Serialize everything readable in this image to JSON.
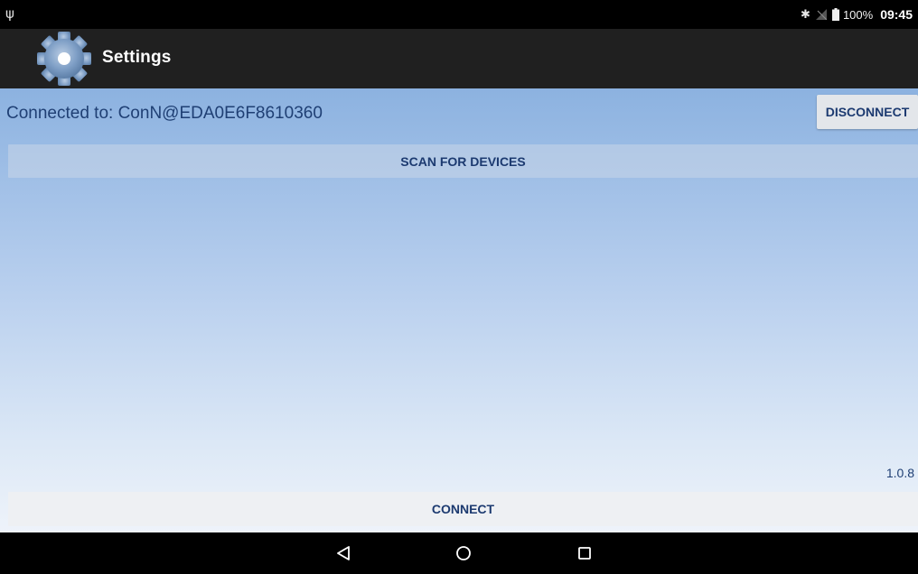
{
  "status_bar": {
    "usb_icon": "usb-icon",
    "bluetooth_icon": "bluetooth-icon",
    "signal_icon": "no-signal-icon",
    "battery_icon": "battery-icon",
    "battery_percent": "100%",
    "time": "09:45"
  },
  "action_bar": {
    "icon": "gear-icon",
    "title": "Settings"
  },
  "main": {
    "connection_status": "Connected to: ConN@EDA0E6F8610360",
    "disconnect_label": "DISCONNECT",
    "scan_label": "SCAN FOR DEVICES",
    "version": "1.0.8",
    "connect_label": "CONNECT"
  },
  "nav_bar": {
    "back_icon": "back-icon",
    "home_icon": "home-icon",
    "recents_icon": "recents-icon"
  },
  "colors": {
    "status_bar_bg": "#000000",
    "action_bar_bg": "#202020",
    "content_gradient_top": "#8cb2e0",
    "content_gradient_bottom": "#eef3fa",
    "text_blue": "#1f3f74",
    "button_bg": "#e3e6ea"
  }
}
